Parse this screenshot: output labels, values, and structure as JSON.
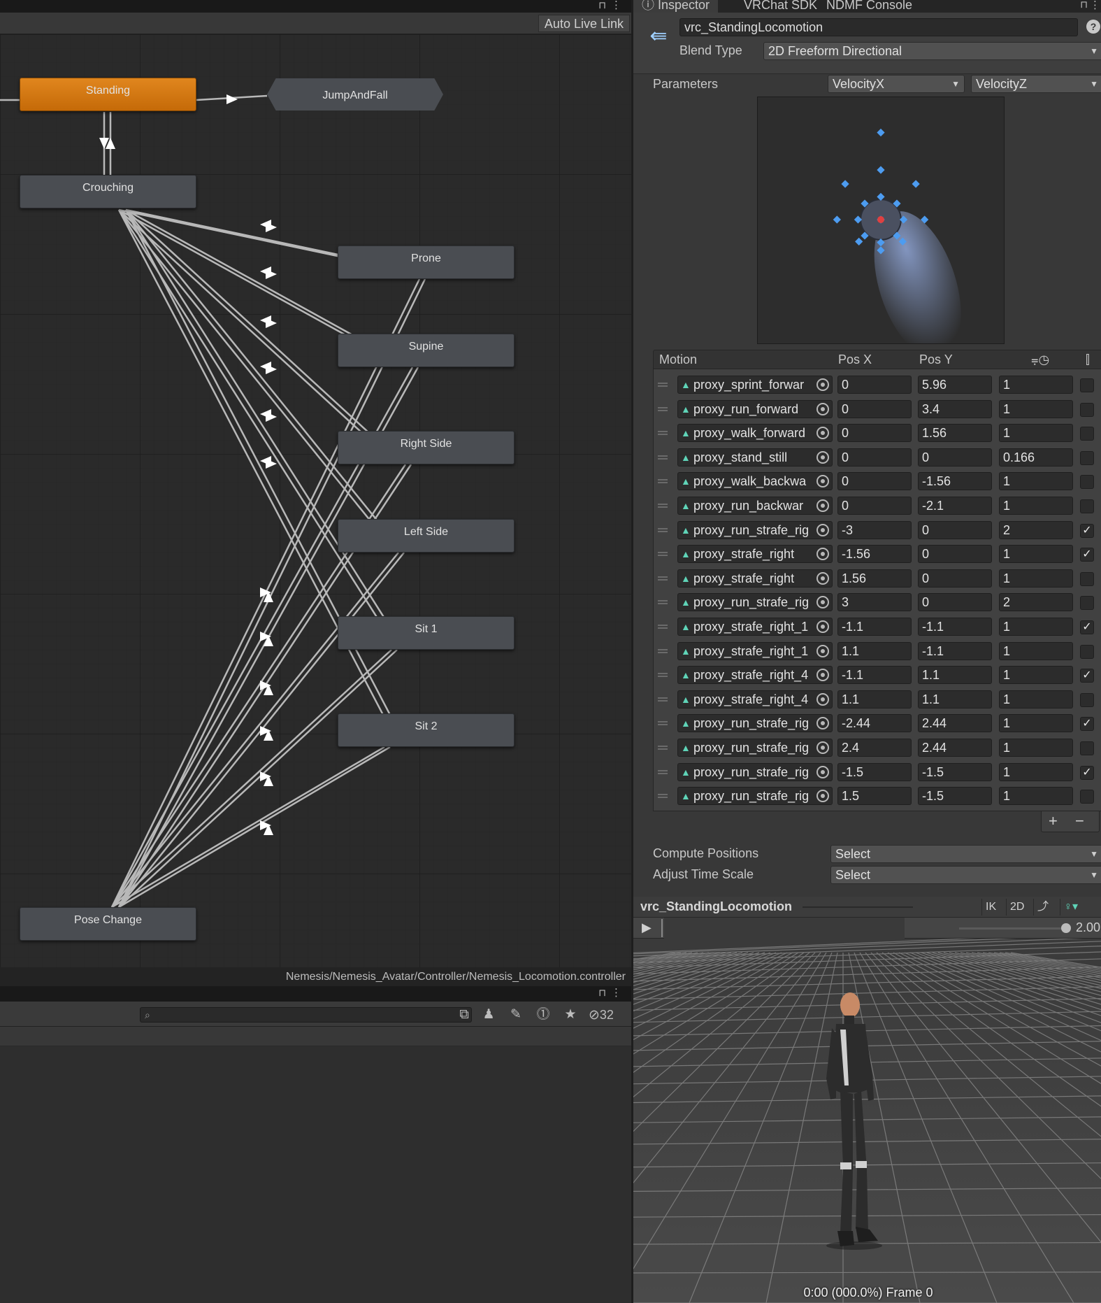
{
  "animator": {
    "auto_live_link": "Auto Live Link",
    "nodes": {
      "standing": "Standing",
      "jump_and_fall": "JumpAndFall",
      "crouching": "Crouching",
      "prone": "Prone",
      "supine": "Supine",
      "right_side": "Right Side",
      "left_side": "Left Side",
      "sit1": "Sit 1",
      "sit2": "Sit 2",
      "pose_change": "Pose Change"
    },
    "colors": {
      "active_state": "#d97a14",
      "state": "#4a4d52",
      "transition": "#b8b8b8"
    },
    "path": "Nemesis/Nemesis_Avatar/Controller/Nemesis_Locomotion.controller"
  },
  "project": {
    "hidden_count": "32",
    "icons": [
      "search-icon",
      "scene-icon",
      "hierarchy-icon",
      "label-icon",
      "warning-icon",
      "star-icon",
      "hidden-eye-icon"
    ]
  },
  "inspector": {
    "tabs": [
      "Inspector",
      "VRChat SDK",
      "NDMF Console"
    ],
    "name": "vrc_StandingLocomotion",
    "blend_type_label": "Blend Type",
    "blend_type": "2D Freeform Directional",
    "parameters_label": "Parameters",
    "param_x": "VelocityX",
    "param_y": "VelocityZ",
    "motion_headers": {
      "motion": "Motion",
      "pos_x": "Pos X",
      "pos_y": "Pos Y"
    },
    "motions": [
      {
        "clip": "proxy_sprint_forwar",
        "x": "0",
        "y": "5.96",
        "t": "1",
        "mirror": false
      },
      {
        "clip": "proxy_run_forward",
        "x": "0",
        "y": "3.4",
        "t": "1",
        "mirror": false
      },
      {
        "clip": "proxy_walk_forward",
        "x": "0",
        "y": "1.56",
        "t": "1",
        "mirror": false
      },
      {
        "clip": "proxy_stand_still",
        "x": "0",
        "y": "0",
        "t": "0.166",
        "mirror": false
      },
      {
        "clip": "proxy_walk_backwa",
        "x": "0",
        "y": "-1.56",
        "t": "1",
        "mirror": false
      },
      {
        "clip": "proxy_run_backwar",
        "x": "0",
        "y": "-2.1",
        "t": "1",
        "mirror": false
      },
      {
        "clip": "proxy_run_strafe_rig",
        "x": "-3",
        "y": "0",
        "t": "2",
        "mirror": true
      },
      {
        "clip": "proxy_strafe_right",
        "x": "-1.56",
        "y": "0",
        "t": "1",
        "mirror": true
      },
      {
        "clip": "proxy_strafe_right",
        "x": "1.56",
        "y": "0",
        "t": "1",
        "mirror": false
      },
      {
        "clip": "proxy_run_strafe_rig",
        "x": "3",
        "y": "0",
        "t": "2",
        "mirror": false
      },
      {
        "clip": "proxy_strafe_right_1",
        "x": "-1.1",
        "y": "-1.1",
        "t": "1",
        "mirror": true
      },
      {
        "clip": "proxy_strafe_right_1",
        "x": "1.1",
        "y": "-1.1",
        "t": "1",
        "mirror": false
      },
      {
        "clip": "proxy_strafe_right_4",
        "x": "-1.1",
        "y": "1.1",
        "t": "1",
        "mirror": true
      },
      {
        "clip": "proxy_strafe_right_4",
        "x": "1.1",
        "y": "1.1",
        "t": "1",
        "mirror": false
      },
      {
        "clip": "proxy_run_strafe_rig",
        "x": "-2.44",
        "y": "2.44",
        "t": "1",
        "mirror": true
      },
      {
        "clip": "proxy_run_strafe_rig",
        "x": "2.4",
        "y": "2.44",
        "t": "1",
        "mirror": false
      },
      {
        "clip": "proxy_run_strafe_rig",
        "x": "-1.5",
        "y": "-1.5",
        "t": "1",
        "mirror": true
      },
      {
        "clip": "proxy_run_strafe_rig",
        "x": "1.5",
        "y": "-1.5",
        "t": "1",
        "mirror": false
      }
    ],
    "add": "+",
    "remove": "−",
    "compute_positions_label": "Compute Positions",
    "compute_positions": "Select",
    "adjust_time_scale_label": "Adjust Time Scale",
    "adjust_time_scale": "Select",
    "colors": {
      "motion_point": "#4d9cf0",
      "current_point": "#e04040"
    }
  },
  "preview": {
    "title": "vrc_StandingLocomotion",
    "ik": "IK",
    "mode_2d": "2D",
    "speed": "2.00",
    "status": "0:00 (000.0%) Frame 0"
  }
}
